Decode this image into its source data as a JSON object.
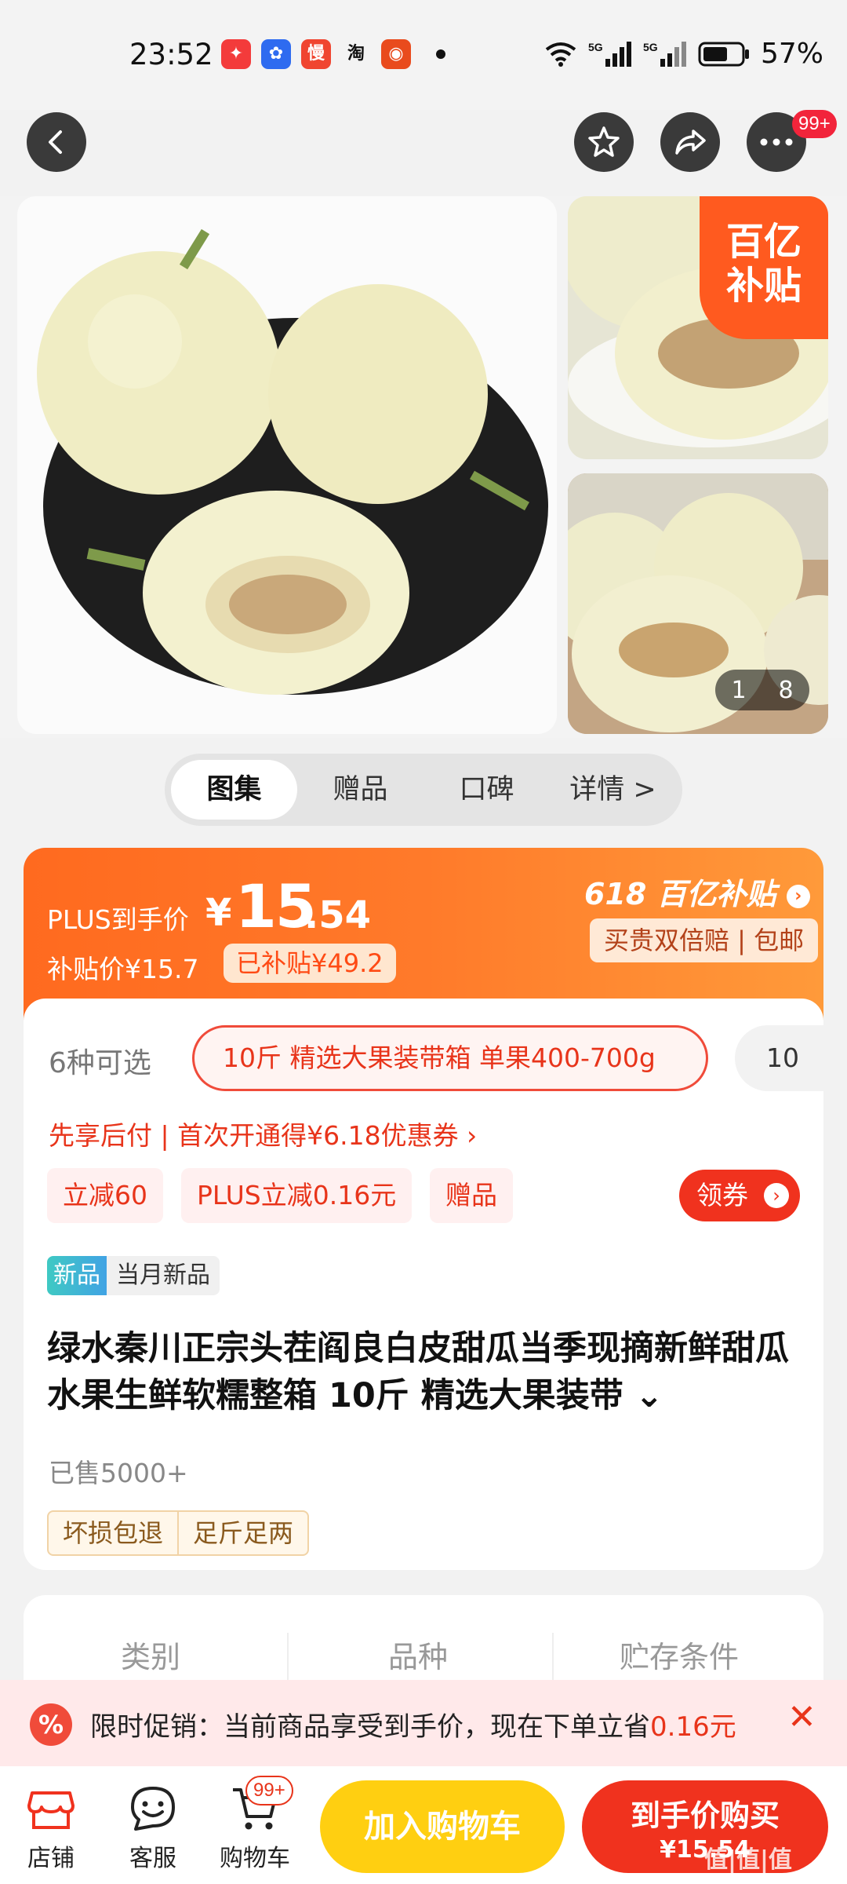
{
  "status_bar": {
    "time": "23:52",
    "app_icons": [
      "app1",
      "app2",
      "慢",
      "淘",
      "app5"
    ],
    "network": "5G",
    "battery": "57%"
  },
  "gallery": {
    "badge_text": "百亿\n补贴",
    "counter_current": "1",
    "counter_total": "8"
  },
  "top_actions": {
    "more_badge": "99+"
  },
  "tabs": [
    {
      "label": "图集"
    },
    {
      "label": "赠品"
    },
    {
      "label": "口碑"
    },
    {
      "label": "详情 >"
    }
  ],
  "price": {
    "plus_label": "PLUS到手价",
    "currency": "¥",
    "plus_int": "15",
    "plus_dec": ".54",
    "subsidy_price": "补贴价¥15.7",
    "subsidized": "已补贴¥49.2",
    "event_brand": "618 百亿补贴",
    "guarantee": "买贵双倍赔 | 包邮"
  },
  "options": {
    "count": "6种可选",
    "selected": "10斤 精选大果装带箱 单果400-700g",
    "next": "10"
  },
  "bnpl": "先享后付 | 首次开通得¥6.18优惠券 ›",
  "promo_tags": [
    "立减60",
    "PLUS立减0.16元",
    "赠品"
  ],
  "coupon_label": "领券",
  "new_tag": {
    "a": "新品",
    "b": "当月新品"
  },
  "title": "绿水秦川正宗头茬阎良白皮甜瓜当季现摘新鲜甜瓜水果生鲜软糯整箱 10斤 精选大果装带 ⌄",
  "sold": "已售5000+",
  "guarantee_tags": [
    "坏损包退",
    "足斤足两"
  ],
  "specs": [
    "类别",
    "品种",
    "贮存条件"
  ],
  "promo_bar": {
    "text": "限时促销：当前商品享受到手价，现在下单立省",
    "amount": "0.16元"
  },
  "bottom_nav": [
    {
      "label": "店铺"
    },
    {
      "label": "客服"
    },
    {
      "label": "购物车"
    }
  ],
  "cart_badge": "99+",
  "add_cart": "加入购物车",
  "buy": {
    "line1": "到手价购买",
    "line2": "¥15.54"
  },
  "watermark": "值|值|值"
}
